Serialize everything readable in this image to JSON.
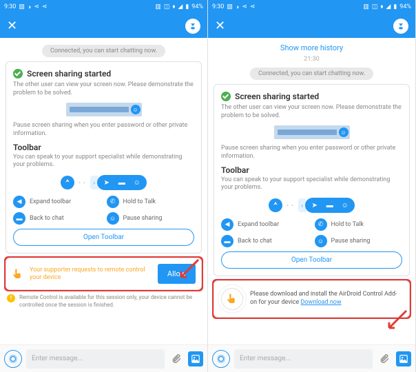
{
  "statusbar": {
    "time": "9:30",
    "battery_text": "94%"
  },
  "header": {},
  "chat": {
    "history_link": "Show more history",
    "timestamp": "21:30",
    "connected_pill": "Connected, you can start chatting now."
  },
  "card": {
    "title": "Screen sharing started",
    "desc": "The other user can view your screen now. Please demonstrate the problem to be solved.",
    "pause_warning": "Pause screen sharing when you enter password or other private information.",
    "toolbar_title": "Toolbar",
    "toolbar_desc": "You can speak to your support specialist while demonstrating your problems.",
    "legend": {
      "expand": "Expand toolbar",
      "hold": "Hold to Talk",
      "back": "Back to chat",
      "pause": "Pause sharing"
    },
    "open_btn": "Open Toolbar"
  },
  "allow": {
    "text": "Your supporter requests to remote control your device",
    "button": "Allow"
  },
  "rc_info": "Remote Control is available for this session only, your device cannot be controlled once the session is finished.",
  "download": {
    "text": "Please download and install the AirDroid Control Add-on for your device ",
    "link": "Download now"
  },
  "footer": {
    "placeholder": "Enter message..."
  }
}
